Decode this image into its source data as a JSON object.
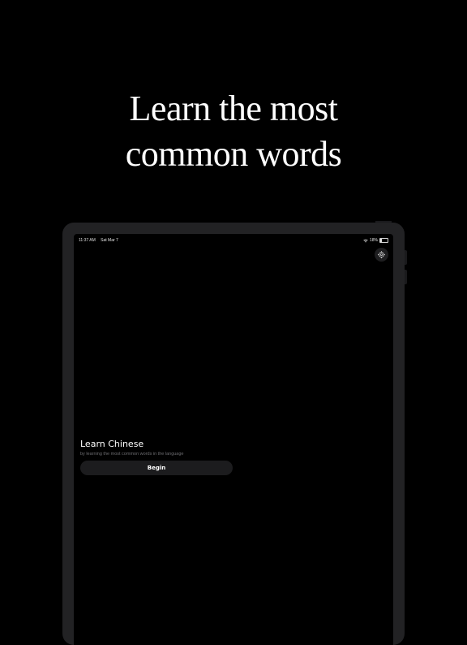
{
  "headline": {
    "line1": "Learn the most",
    "line2": "common words"
  },
  "status_bar": {
    "time": "11:37 AM",
    "date": "Sat Mar 7",
    "battery_label": "18%",
    "battery_level": 0.18,
    "wifi_icon": "wifi-icon",
    "battery_icon": "battery-icon"
  },
  "toolbar": {
    "settings_icon": "gear-icon"
  },
  "main": {
    "title": "Learn Chinese",
    "subtitle": "by learning the most common words in the language",
    "begin_label": "Begin"
  },
  "colors": {
    "background": "#000000",
    "device_frame": "#222224",
    "button_bg": "#1c1c1e",
    "subtitle_text": "#6e6e72"
  }
}
